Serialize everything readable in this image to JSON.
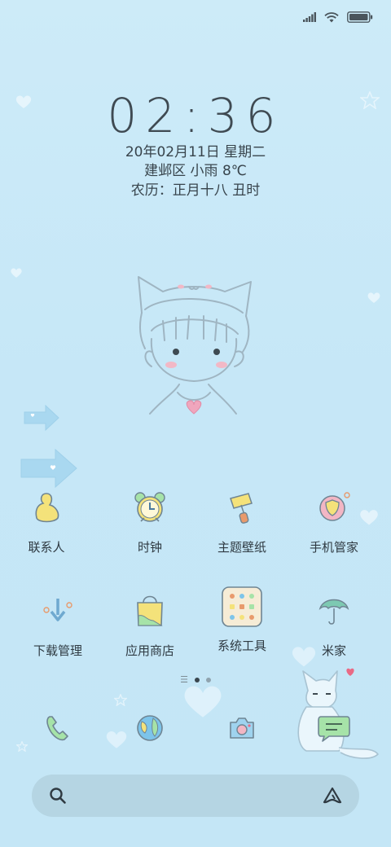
{
  "status_bar": {
    "icons": [
      "signal-icon",
      "wifi-icon",
      "battery-icon"
    ]
  },
  "lockscreen": {
    "time": "02:36",
    "date_weekday": "20年02月11日 星期二",
    "location_weather": "建邺区  小雨  8℃",
    "lunar": "农历：正月十八 丑时"
  },
  "apps": [
    {
      "label": "联系人",
      "icon": "contacts-icon"
    },
    {
      "label": "时钟",
      "icon": "clock-icon"
    },
    {
      "label": "主题壁纸",
      "icon": "themes-icon"
    },
    {
      "label": "手机管家",
      "icon": "security-icon"
    },
    {
      "label": "下载管理",
      "icon": "downloads-icon"
    },
    {
      "label": "应用商店",
      "icon": "app-store-icon"
    },
    {
      "label": "系统工具",
      "icon": "tools-folder-icon"
    },
    {
      "label": "米家",
      "icon": "mi-home-icon"
    }
  ],
  "pager": {
    "pages": 2,
    "current": 1
  },
  "dock": [
    {
      "icon": "phone-icon"
    },
    {
      "icon": "browser-icon"
    },
    {
      "icon": "camera-icon"
    },
    {
      "icon": "messages-icon"
    }
  ],
  "search": {
    "placeholder": "",
    "icon": "search-icon",
    "assistant_icon": "assistant-icon"
  },
  "colors": {
    "background": "#c9e9f7",
    "search_bar": "#b5d5e3",
    "text": "#2f3a42",
    "accent_yellow": "#f4e27a",
    "accent_green": "#a6e3a8",
    "accent_blue": "#7dc4ea"
  }
}
